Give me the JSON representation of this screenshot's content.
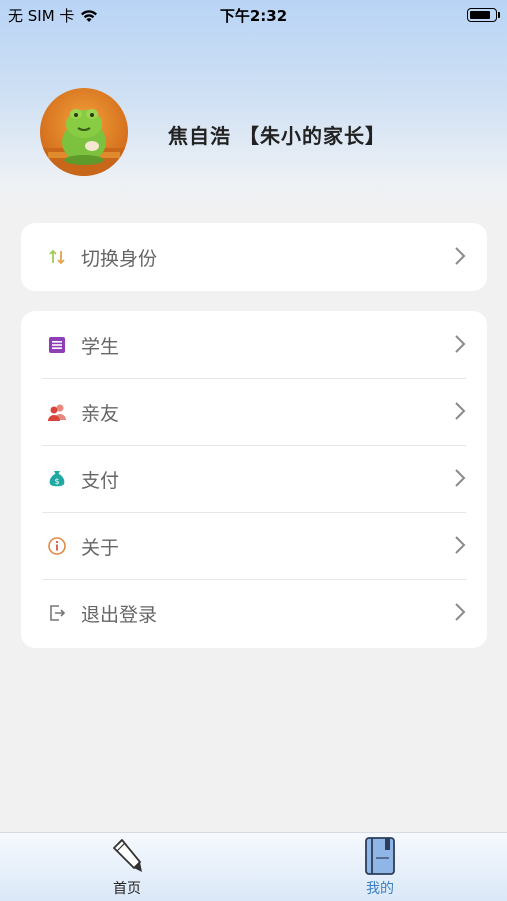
{
  "status_bar": {
    "carrier": "无 SIM 卡",
    "time": "下午2:32",
    "battery_level": 0.85
  },
  "profile": {
    "name": "焦自浩 【朱小的家长】",
    "avatar_icon": "frog-avatar-icon"
  },
  "switch_card": {
    "label": "切换身份",
    "icon": "switch-arrows-icon",
    "icon_color": "#8bc34a"
  },
  "menu": {
    "items": [
      {
        "label": "学生",
        "icon": "student-card-icon",
        "icon_color": "#8e3fb8"
      },
      {
        "label": "亲友",
        "icon": "friends-icon",
        "icon_color": "#e0574a"
      },
      {
        "label": "支付",
        "icon": "money-bag-icon",
        "icon_color": "#1fa9a2"
      },
      {
        "label": "关于",
        "icon": "info-icon",
        "icon_color": "#e08a4a"
      },
      {
        "label": "退出登录",
        "icon": "logout-icon",
        "icon_color": "#777777"
      }
    ]
  },
  "tab_bar": {
    "tabs": [
      {
        "label": "首页",
        "icon": "pencil-icon",
        "active": false
      },
      {
        "label": "我的",
        "icon": "notebook-icon",
        "active": true
      }
    ],
    "active_color": "#3a80c4"
  }
}
